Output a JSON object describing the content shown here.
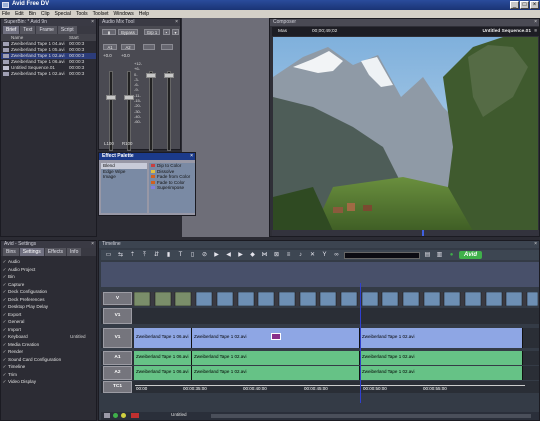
{
  "app": {
    "title": "Avid Free DV"
  },
  "menu": [
    "File",
    "Edit",
    "Bin",
    "Clip",
    "Special",
    "Tools",
    "Toolset",
    "Windows",
    "Help"
  ],
  "bin": {
    "title": "SuperBin: * Avid 9n",
    "tabs": [
      "Brief",
      "Text",
      "Frame",
      "Script"
    ],
    "columns": [
      "Name",
      "Start"
    ],
    "rows": [
      {
        "name": "Zweiberland Tape 1 04.avi",
        "start": "00:00:3",
        "selected": false
      },
      {
        "name": "Zweiberland Tape 1 05.avi",
        "start": "00:00:3",
        "selected": false
      },
      {
        "name": "Zweiberland Tape 1 02.avi",
        "start": "00:00:3",
        "selected": true
      },
      {
        "name": "Zweiberland Tape 1 06.avi",
        "start": "00:00:3",
        "selected": false
      },
      {
        "name": "Untitled Sequence.01",
        "start": "00:00:3",
        "selected": false
      },
      {
        "name": "Zweiberland Tape 1 02.avi",
        "start": "00:00:3",
        "selected": false
      }
    ]
  },
  "audio_mix": {
    "title": "Audio Mix Tool",
    "bypass": "Bypass",
    "group": "Grp 1",
    "channels": [
      "A1",
      "A2"
    ],
    "levels": [
      "+0.0",
      "+0.0"
    ],
    "scale": [
      "+12-",
      "+6-",
      "0-",
      "-3-",
      "-6-",
      "-9-",
      "-11-",
      "-15-",
      "-20-",
      "-30-",
      "-40-",
      "-60-"
    ],
    "bottom_labels": [
      "L100",
      "R100"
    ]
  },
  "composer": {
    "title": "Composer",
    "left_info": "Mas",
    "timecode": "00;00;49;02",
    "sequence": "Untitled Sequence.01"
  },
  "effect_palette": {
    "title": "Effect Palette",
    "categories": [
      "Blend",
      "Edge Wipe",
      "Image"
    ],
    "effects": [
      {
        "name": "Dip to Color",
        "color": "#c84040"
      },
      {
        "name": "Dissolve",
        "color": "#e0c040"
      },
      {
        "name": "Fade from Color",
        "color": "#d06020"
      },
      {
        "name": "Fade to Color",
        "color": "#d06020"
      },
      {
        "name": "Superimpose",
        "color": "#8080e0"
      }
    ]
  },
  "project": {
    "title": "Avid - Settings",
    "tabs": [
      "Bins",
      "Settings",
      "Effects",
      "Info"
    ],
    "settings": [
      {
        "name": "Audio",
        "value": ""
      },
      {
        "name": "Audio Project",
        "value": ""
      },
      {
        "name": "Bin",
        "value": ""
      },
      {
        "name": "Capture",
        "value": ""
      },
      {
        "name": "Deck Configuration",
        "value": ""
      },
      {
        "name": "Deck Preferences",
        "value": ""
      },
      {
        "name": "Desktop Play Delay",
        "value": ""
      },
      {
        "name": "Export",
        "value": ""
      },
      {
        "name": "General",
        "value": ""
      },
      {
        "name": "Import",
        "value": ""
      },
      {
        "name": "Keyboard",
        "value": "Untitled"
      },
      {
        "name": "Media Creation",
        "value": ""
      },
      {
        "name": "Render",
        "value": ""
      },
      {
        "name": "Sound Card Configuration",
        "value": ""
      },
      {
        "name": "Timeline",
        "value": ""
      },
      {
        "name": "Trim",
        "value": ""
      },
      {
        "name": "Video Display",
        "value": ""
      }
    ]
  },
  "timeline": {
    "title": "Timeline",
    "brand": "Avid",
    "tracks": [
      "V",
      "V1",
      "V1",
      "A1",
      "A2",
      "TC1"
    ],
    "v1_clips": [
      "Zweiberland Tape 1 06.avi",
      "Zweiberland Tape 1 02.avi",
      "Zweiberland Tape 1 02.avi"
    ],
    "a1_clips": [
      "Zweiberland Tape 1 06.avi",
      "Zweiberland Tape 1 02.avi",
      "Zweiberland Tape 1 02.avi"
    ],
    "a2_clips": [
      "Zweiberland Tape 1 06.avi",
      "Zweiberland Tape 1 02.avi",
      "Zweiberland Tape 1 02.avi"
    ],
    "timecodes": [
      "00:00",
      "00:00:35:00",
      "00:00:40:00",
      "00:00:45:00",
      "00:00:50:00",
      "00:00:55:00"
    ],
    "bottom_label": "Untitled"
  },
  "colors": {
    "title_bar": "#1a3475",
    "v_clip": "#8ea6e4",
    "a_clip": "#66c286",
    "brand_green": "#3fb04a"
  }
}
